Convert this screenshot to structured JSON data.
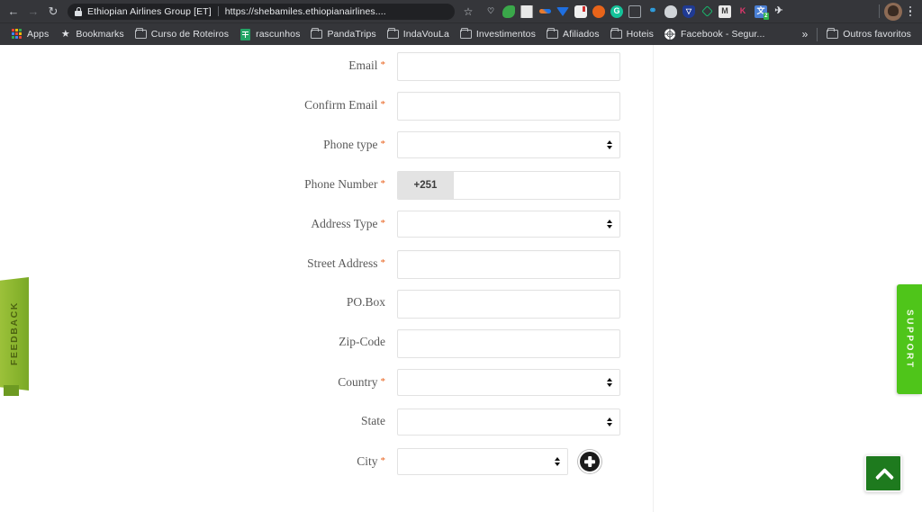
{
  "browser": {
    "nav": {
      "back_icon": "arrow-left-icon",
      "forward_icon": "arrow-right-icon",
      "reload_icon": "reload-icon",
      "back_glyph": "←",
      "forward_glyph": "→",
      "reload_glyph": "↻"
    },
    "omnibox": {
      "page_title": "Ethiopian Airlines Group [ET]",
      "url": "https://shebamiles.ethiopianairlines....",
      "lock_icon": "lock-icon",
      "star_icon": "star-icon",
      "star_glyph": "☆"
    },
    "extensions": [
      {
        "name": "pocket-extension-icon",
        "label": "♡",
        "bg": "transparent",
        "fg": "#9aa0a6",
        "shape": "rnd"
      },
      {
        "name": "evernote-extension-icon",
        "label": "",
        "bg": "#3aa84a",
        "fg": "#fff",
        "shape": "blob"
      },
      {
        "name": "dictionary-extension-icon",
        "label": "",
        "bg": "#e8e8e8",
        "fg": "#555",
        "shape": "book"
      },
      {
        "name": "colorpicker-extension-icon",
        "label": "",
        "bg": "transparent",
        "fg": "#e87a2b",
        "shape": "pen"
      },
      {
        "name": "dropbox-extension-icon",
        "label": "",
        "bg": "transparent",
        "fg": "#1f6fe0",
        "shape": "box"
      },
      {
        "name": "addon-extension-icon",
        "label": "",
        "bg": "#f0f0f0",
        "fg": "#d02b2b",
        "shape": "puzzle"
      },
      {
        "name": "brave-extension-icon",
        "label": "",
        "bg": "#e8641a",
        "fg": "#fff",
        "shape": "rnd"
      },
      {
        "name": "grammarly-extension-icon",
        "label": "G",
        "bg": "#15c39a",
        "fg": "#fff",
        "shape": "rnd"
      },
      {
        "name": "pinterest-save-extension-icon",
        "label": "",
        "bg": "transparent",
        "fg": "#9aa0a6",
        "shape": "tag"
      },
      {
        "name": "link-extension-icon",
        "label": "",
        "bg": "transparent",
        "fg": "#2f9fe0",
        "shape": "link"
      },
      {
        "name": "cloud-extension-icon",
        "label": "",
        "bg": "#d0d4d8",
        "fg": "#555",
        "shape": "cloud"
      },
      {
        "name": "honey-extension-icon",
        "label": "",
        "bg": "#1f3a93",
        "fg": "#fff",
        "shape": "shield"
      },
      {
        "name": "vpn-extension-icon",
        "label": "",
        "bg": "transparent",
        "fg": "#19b36b",
        "shape": "diamond"
      },
      {
        "name": "mendeley-extension-icon",
        "label": "M",
        "bg": "#e9e9e9",
        "fg": "#3a3a3a",
        "shape": "sq"
      },
      {
        "name": "klarna-extension-icon",
        "label": "K",
        "bg": "transparent",
        "fg": "#e0376c",
        "shape": "sq"
      },
      {
        "name": "translate-extension-icon",
        "label": "文",
        "bg": "#4a7fd4",
        "fg": "#fff",
        "shape": "sq",
        "badge": "2"
      },
      {
        "name": "flight-tracker-extension-icon",
        "label": "✈",
        "bg": "transparent",
        "fg": "#dfe1e5",
        "shape": "plain"
      }
    ],
    "profile": {
      "avatar_icon": "avatar",
      "menu_icon": "kebab-menu-icon"
    },
    "bookmarks": [
      {
        "label": "Apps",
        "icon": "apps-grid-icon",
        "type": "apps"
      },
      {
        "label": "Bookmarks",
        "icon": "star-icon",
        "type": "star"
      },
      {
        "label": "Curso de Roteiros",
        "icon": "folder-icon",
        "type": "folder"
      },
      {
        "label": "rascunhos",
        "icon": "google-sheets-icon",
        "type": "sheets"
      },
      {
        "label": "PandaTrips",
        "icon": "folder-icon",
        "type": "folder"
      },
      {
        "label": "IndaVouLa",
        "icon": "folder-icon",
        "type": "folder"
      },
      {
        "label": "Investimentos",
        "icon": "folder-icon",
        "type": "folder"
      },
      {
        "label": "Afiliados",
        "icon": "folder-icon",
        "type": "folder"
      },
      {
        "label": "Hoteis",
        "icon": "folder-icon",
        "type": "folder"
      },
      {
        "label": "Facebook - Segur...",
        "icon": "globe-icon",
        "type": "globe"
      }
    ],
    "bookmarks_overflow_glyph": "»",
    "other_bookmarks": {
      "label": "Outros favoritos",
      "icon": "folder-icon"
    }
  },
  "form": {
    "required_marker": "*",
    "fields": [
      {
        "label": "Email",
        "required": true,
        "type": "text",
        "value": "",
        "placeholder": ""
      },
      {
        "label": "Confirm Email",
        "required": true,
        "type": "text",
        "value": "",
        "placeholder": ""
      },
      {
        "label": "Phone type",
        "required": true,
        "type": "select",
        "value": "",
        "placeholder": ""
      },
      {
        "label": "Phone Number",
        "required": true,
        "type": "phone",
        "prefix": "+251",
        "value": "",
        "placeholder": ""
      },
      {
        "label": "Address Type",
        "required": true,
        "type": "select",
        "value": "",
        "placeholder": ""
      },
      {
        "label": "Street Address",
        "required": true,
        "type": "text",
        "value": "",
        "placeholder": ""
      },
      {
        "label": "PO.Box",
        "required": false,
        "type": "text",
        "value": "",
        "placeholder": ""
      },
      {
        "label": "Zip-Code",
        "required": false,
        "type": "text",
        "value": "",
        "placeholder": ""
      },
      {
        "label": "Country",
        "required": true,
        "type": "select",
        "value": "",
        "placeholder": ""
      },
      {
        "label": "State",
        "required": false,
        "type": "select",
        "value": "",
        "placeholder": ""
      },
      {
        "label": "City",
        "required": true,
        "type": "select-add",
        "value": "",
        "placeholder": "",
        "add_button_icon": "plus-circle-icon"
      }
    ]
  },
  "widgets": {
    "feedback_tab": {
      "label": "FEEDBACK",
      "color": "#8ab52e"
    },
    "support_tab": {
      "label": "SUPPORT",
      "color": "#4fc51a"
    },
    "scroll_top": {
      "icon": "chevron-up-icon",
      "color": "#1e7a1e"
    }
  }
}
